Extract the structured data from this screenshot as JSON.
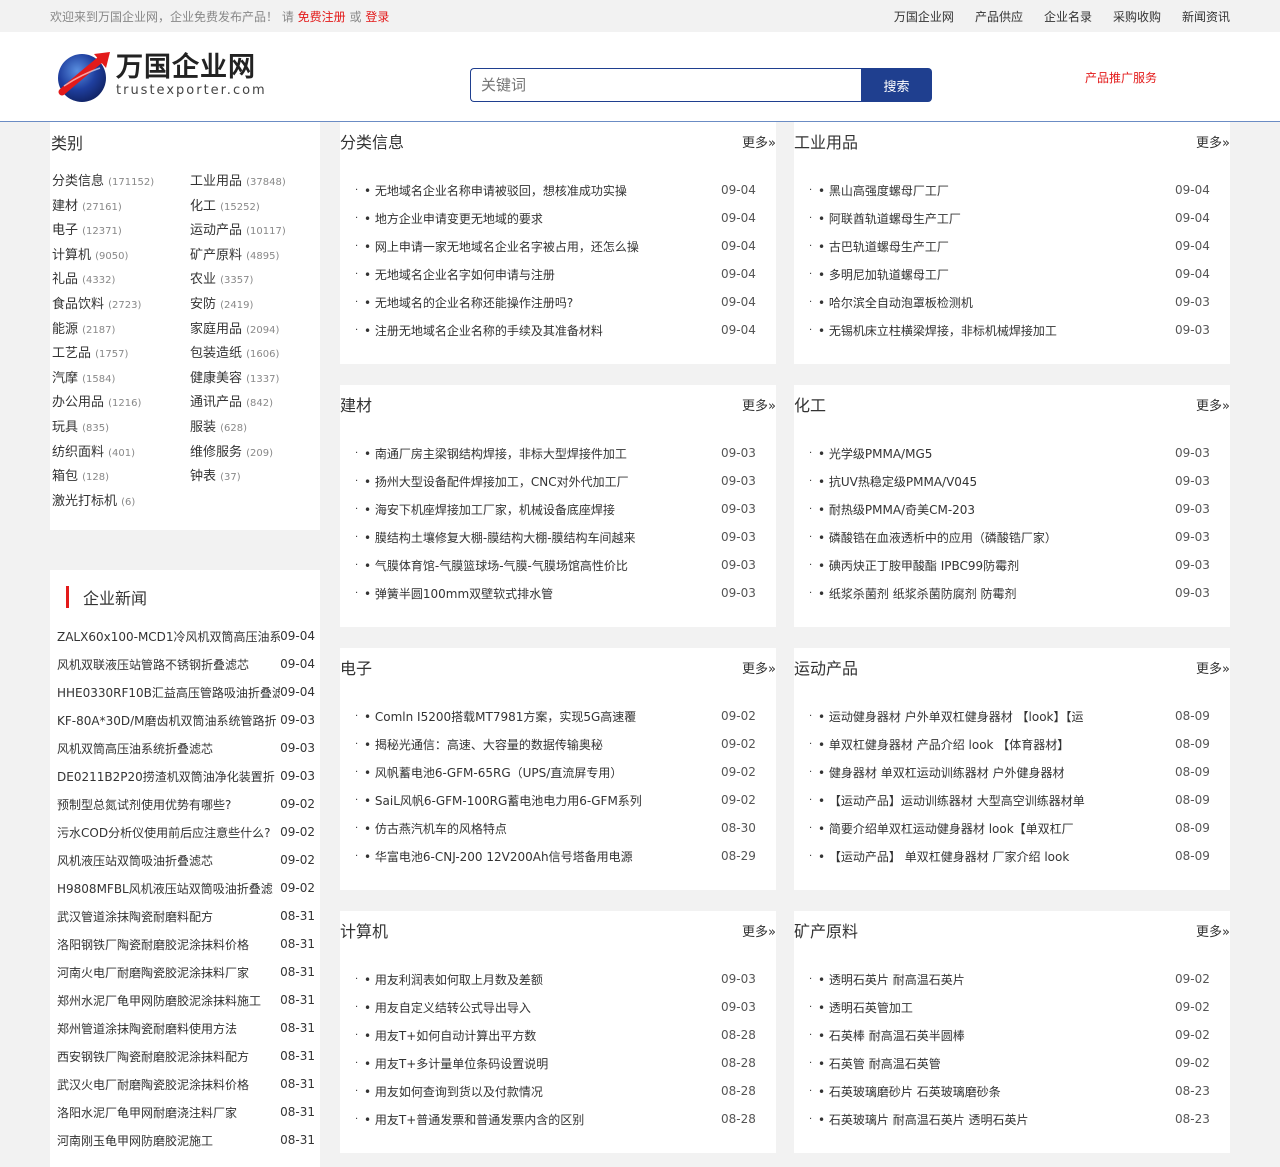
{
  "topbar": {
    "welcome": "欢迎来到万国企业网，企业免费发布产品！ 请",
    "register": "免费注册",
    "or": "或",
    "login": "登录",
    "nav": [
      "万国企业网",
      "产品供应",
      "企业名录",
      "采购收购",
      "新闻资讯"
    ]
  },
  "header": {
    "logo_cn": "万国企业网",
    "logo_en": "trustexporter.com",
    "search_placeholder": "关键词",
    "search_button": "搜索",
    "promo": "产品推广服务"
  },
  "categories": {
    "title": "类别",
    "items": [
      {
        "name": "分类信息",
        "count": "(171152)"
      },
      {
        "name": "工业用品",
        "count": "(37848)"
      },
      {
        "name": "建材",
        "count": "(27161)"
      },
      {
        "name": "化工",
        "count": "(15252)"
      },
      {
        "name": "电子",
        "count": "(12371)"
      },
      {
        "name": "运动产品",
        "count": "(10117)"
      },
      {
        "name": "计算机",
        "count": "(9050)"
      },
      {
        "name": "矿产原料",
        "count": "(4895)"
      },
      {
        "name": "礼品",
        "count": "(4332)"
      },
      {
        "name": "农业",
        "count": "(3357)"
      },
      {
        "name": "食品饮料",
        "count": "(2723)"
      },
      {
        "name": "安防",
        "count": "(2419)"
      },
      {
        "name": "能源",
        "count": "(2187)"
      },
      {
        "name": "家庭用品",
        "count": "(2094)"
      },
      {
        "name": "工艺品",
        "count": "(1757)"
      },
      {
        "name": "包装造纸",
        "count": "(1606)"
      },
      {
        "name": "汽摩",
        "count": "(1584)"
      },
      {
        "name": "健康美容",
        "count": "(1337)"
      },
      {
        "name": "办公用品",
        "count": "(1216)"
      },
      {
        "name": "通讯产品",
        "count": "(842)"
      },
      {
        "name": "玩具",
        "count": "(835)"
      },
      {
        "name": "服装",
        "count": "(628)"
      },
      {
        "name": "纺织面料",
        "count": "(401)"
      },
      {
        "name": "维修服务",
        "count": "(209)"
      },
      {
        "name": "箱包",
        "count": "(128)"
      },
      {
        "name": "钟表",
        "count": "(37)"
      },
      {
        "name": "激光打标机",
        "count": "(6)"
      }
    ]
  },
  "company_news": {
    "title": "企业新闻",
    "items": [
      {
        "title": "ZALX60x100-MCD1冷风机双筒高压油系",
        "date": "09-04"
      },
      {
        "title": "风机双联液压站管路不锈钢折叠滤芯",
        "date": "09-04"
      },
      {
        "title": "HHE0330RF10B汇益高压管路吸油折叠滤",
        "date": "09-04"
      },
      {
        "title": "KF-80A*30D/M磨齿机双筒油系统管路折",
        "date": "09-03"
      },
      {
        "title": "风机双筒高压油系统折叠滤芯",
        "date": "09-03"
      },
      {
        "title": "DE0211B2P20捞渣机双筒油净化装置折",
        "date": "09-03"
      },
      {
        "title": "预制型总氮试剂使用优势有哪些?",
        "date": "09-02"
      },
      {
        "title": "污水COD分析仪使用前后应注意些什么?",
        "date": "09-02"
      },
      {
        "title": "风机液压站双筒吸油折叠滤芯",
        "date": "09-02"
      },
      {
        "title": "H9808MFBL风机液压站双筒吸油折叠滤",
        "date": "09-02"
      },
      {
        "title": "武汉管道涂抹陶瓷耐磨料配方",
        "date": "08-31"
      },
      {
        "title": "洛阳钢铁厂陶瓷耐磨胶泥涂抹料价格",
        "date": "08-31"
      },
      {
        "title": "河南火电厂耐磨陶瓷胶泥涂抹料厂家",
        "date": "08-31"
      },
      {
        "title": "郑州水泥厂龟甲网防磨胶泥涂抹料施工",
        "date": "08-31"
      },
      {
        "title": "郑州管道涂抹陶瓷耐磨料使用方法",
        "date": "08-31"
      },
      {
        "title": "西安钢铁厂陶瓷耐磨胶泥涂抹料配方",
        "date": "08-31"
      },
      {
        "title": "武汉火电厂耐磨陶瓷胶泥涂抹料价格",
        "date": "08-31"
      },
      {
        "title": "洛阳水泥厂龟甲网耐磨浇注料厂家",
        "date": "08-31"
      },
      {
        "title": "河南刚玉龟甲网防磨胶泥施工",
        "date": "08-31"
      }
    ]
  },
  "more_label": "更多»",
  "panels": [
    {
      "title": "分类信息",
      "items": [
        {
          "title": "无地域名企业名称申请被驳回，想核准成功实操",
          "date": "09-04"
        },
        {
          "title": "地方企业申请变更无地域的要求",
          "date": "09-04"
        },
        {
          "title": "网上申请一家无地域名企业名字被占用，还怎么操",
          "date": "09-04"
        },
        {
          "title": "无地域名企业名字如何申请与注册",
          "date": "09-04"
        },
        {
          "title": "无地域名的企业名称还能操作注册吗?",
          "date": "09-04"
        },
        {
          "title": "注册无地域名企业名称的手续及其准备材料",
          "date": "09-04"
        }
      ]
    },
    {
      "title": "工业用品",
      "items": [
        {
          "title": "黑山高强度螺母厂工厂",
          "date": "09-04"
        },
        {
          "title": "阿联酋轨道螺母生产工厂",
          "date": "09-04"
        },
        {
          "title": "古巴轨道螺母生产工厂",
          "date": "09-04"
        },
        {
          "title": "多明尼加轨道螺母工厂",
          "date": "09-04"
        },
        {
          "title": "哈尔滨全自动泡罩板检测机",
          "date": "09-03"
        },
        {
          "title": "无锡机床立柱横梁焊接，非标机械焊接加工",
          "date": "09-03"
        }
      ]
    },
    {
      "title": "建材",
      "items": [
        {
          "title": "南通厂房主梁钢结构焊接，非标大型焊接件加工",
          "date": "09-03"
        },
        {
          "title": "扬州大型设备配件焊接加工，CNC对外代加工厂",
          "date": "09-03"
        },
        {
          "title": "海安下机座焊接加工厂家，机械设备底座焊接",
          "date": "09-03"
        },
        {
          "title": "膜结构土壤修复大棚-膜结构大棚-膜结构车间越来",
          "date": "09-03"
        },
        {
          "title": "气膜体育馆-气膜篮球场-气膜-气膜场馆高性价比",
          "date": "09-03"
        },
        {
          "title": "弹簧半圆100mm双壁软式排水管",
          "date": "09-03"
        }
      ]
    },
    {
      "title": "化工",
      "items": [
        {
          "title": "光学级PMMA/MG5",
          "date": "09-03"
        },
        {
          "title": "抗UV热稳定级PMMA/V045",
          "date": "09-03"
        },
        {
          "title": "耐热级PMMA/奇美CM-203",
          "date": "09-03"
        },
        {
          "title": "磷酸锆在血液透析中的应用（磷酸锆厂家）",
          "date": "09-03"
        },
        {
          "title": "碘丙炔正丁胺甲酸酯 IPBC99防霉剂",
          "date": "09-03"
        },
        {
          "title": "纸浆杀菌剂 纸浆杀菌防腐剂 防霉剂",
          "date": "09-03"
        }
      ]
    },
    {
      "title": "电子",
      "items": [
        {
          "title": "Comln I5200搭载MT7981方案，实现5G高速覆",
          "date": "09-02"
        },
        {
          "title": "揭秘光通信：高速、大容量的数据传输奥秘",
          "date": "09-02"
        },
        {
          "title": "风帆蓄电池6-GFM-65RG（UPS/直流屏专用）",
          "date": "09-02"
        },
        {
          "title": "SaiL风帆6-GFM-100RG蓄电池电力用6-GFM系列",
          "date": "09-02"
        },
        {
          "title": "仿古燕汽机车的风格特点",
          "date": "08-30"
        },
        {
          "title": "华富电池6-CNJ-200 12V200Ah信号塔备用电源",
          "date": "08-29"
        }
      ]
    },
    {
      "title": "运动产品",
      "items": [
        {
          "title": "运动健身器材 户外单双杠健身器材 【look】【运",
          "date": "08-09"
        },
        {
          "title": "单双杠健身器材 产品介绍 look 【体育器材】",
          "date": "08-09"
        },
        {
          "title": "健身器材 单双杠运动训练器材 户外健身器材",
          "date": "08-09"
        },
        {
          "title": "【运动产品】运动训练器材 大型高空训练器材单",
          "date": "08-09"
        },
        {
          "title": "简要介绍单双杠运动健身器材 look【单双杠厂",
          "date": "08-09"
        },
        {
          "title": "【运动产品】 单双杠健身器材 厂家介绍 look",
          "date": "08-09"
        }
      ]
    },
    {
      "title": "计算机",
      "items": [
        {
          "title": "用友利润表如何取上月数及差额",
          "date": "09-03"
        },
        {
          "title": "用友自定义结转公式导出导入",
          "date": "09-03"
        },
        {
          "title": "用友T+如何自动计算出平方数",
          "date": "08-28"
        },
        {
          "title": "用友T+多计量单位条码设置说明",
          "date": "08-28"
        },
        {
          "title": "用友如何查询到货以及付款情况",
          "date": "08-28"
        },
        {
          "title": "用友T+普通发票和普通发票内含的区别",
          "date": "08-28"
        }
      ]
    },
    {
      "title": "矿产原料",
      "items": [
        {
          "title": "透明石英片 耐高温石英片",
          "date": "09-02"
        },
        {
          "title": "透明石英管加工",
          "date": "09-02"
        },
        {
          "title": "石英棒 耐高温石英半圆棒",
          "date": "09-02"
        },
        {
          "title": "石英管 耐高温石英管",
          "date": "09-02"
        },
        {
          "title": "石英玻璃磨砂片 石英玻璃磨砂条",
          "date": "08-23"
        },
        {
          "title": "石英玻璃片 耐高温石英片 透明石英片",
          "date": "08-23"
        }
      ]
    }
  ],
  "colors": {
    "accent_red": "#e31a1a",
    "brand_blue": "#1f3f8f"
  }
}
